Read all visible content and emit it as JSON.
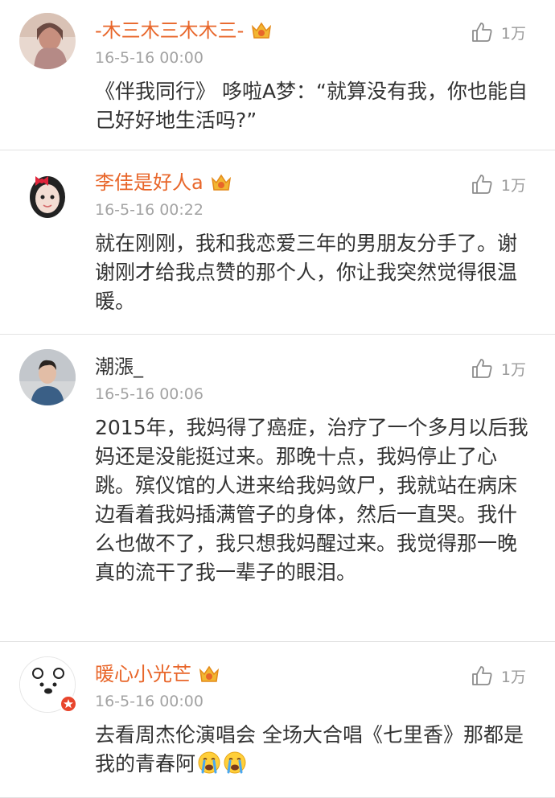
{
  "comments": [
    {
      "username": "-木三木三木木三-",
      "time": "16-5-16 00:00",
      "likes": "1万",
      "text": "《伴我同行》 哆啦A梦：“就算没有我，你也能自己好好地生活吗?”",
      "vip": true,
      "name_color": "#e8662a"
    },
    {
      "username": "李佳是好人a",
      "time": "16-5-16 00:22",
      "likes": "1万",
      "text": "就在刚刚，我和我恋爱三年的男朋友分手了。谢谢刚才给我点赞的那个人，你让我突然觉得很温暖。",
      "vip": true,
      "name_color": "#e8662a"
    },
    {
      "username": "潮漲_",
      "time": "16-5-16 00:06",
      "likes": "1万",
      "text": "2015年，我妈得了癌症，治疗了一个多月以后我妈还是没能挺过来。那晚十点，我妈停止了心跳。殡仪馆的人进来给我妈敛尸，我就站在病床边看着我妈插满管子的身体，然后一直哭。我什么也做不了，我只想我妈醒过来。我觉得那一晚真的流干了我一辈子的眼泪。",
      "vip": false,
      "name_color": "#333333"
    },
    {
      "username": "暖心小光芒",
      "time": "16-5-16 00:00",
      "likes": "1万",
      "text": "去看周杰伦演唱会  全场大合唱《七里香》那都是我的青春阿",
      "vip": true,
      "name_color": "#e8662a",
      "emojis": [
        "crying-face-icon",
        "crying-face-icon"
      ]
    }
  ]
}
